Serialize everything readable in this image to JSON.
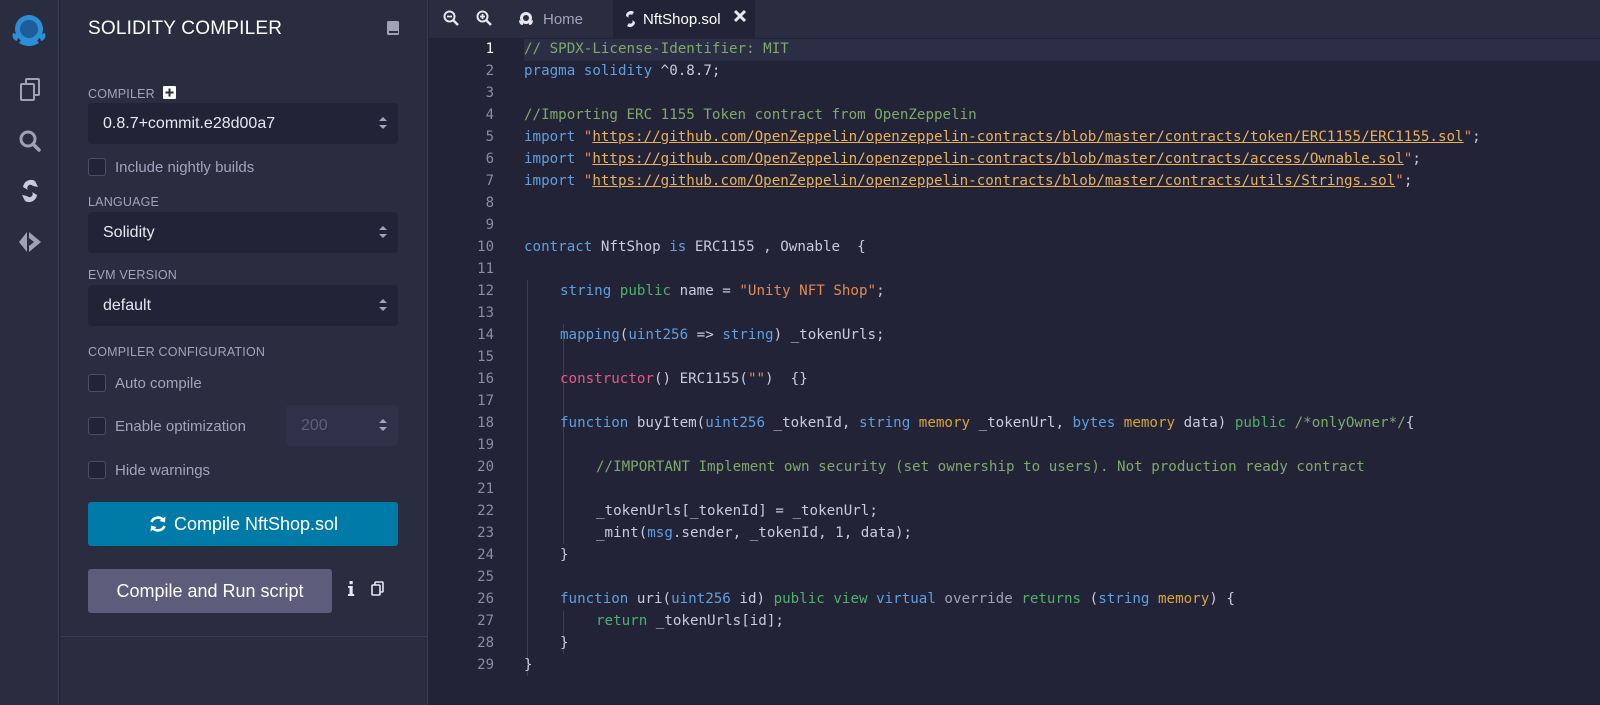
{
  "rail": {
    "items": [
      "remix-logo-icon",
      "file-explorer-icon",
      "search-icon",
      "solidity-compiler-icon",
      "deploy-run-icon"
    ]
  },
  "panel": {
    "title": "SOLIDITY COMPILER",
    "compiler_label": "COMPILER",
    "compiler_version": "0.8.7+commit.e28d00a7",
    "nightly_label": "Include nightly builds",
    "language_label": "LANGUAGE",
    "language_value": "Solidity",
    "evm_label": "EVM VERSION",
    "evm_value": "default",
    "config_label": "COMPILER CONFIGURATION",
    "auto_compile_label": "Auto compile",
    "optimization_label": "Enable optimization",
    "runs_value": "200",
    "hide_warnings_label": "Hide warnings",
    "compile_button": "Compile NftShop.sol",
    "run_script_button": "Compile and Run script"
  },
  "tabs": {
    "home": "Home",
    "file": "NftShop.sol"
  },
  "editor": {
    "line_numbers": [
      "1",
      "2",
      "3",
      "4",
      "5",
      "6",
      "7",
      "8",
      "9",
      "10",
      "11",
      "12",
      "13",
      "14",
      "15",
      "16",
      "17",
      "18",
      "19",
      "20",
      "21",
      "22",
      "23",
      "24",
      "25",
      "26",
      "27",
      "28",
      "29"
    ],
    "code": {
      "l1": "// SPDX-License-Identifier: MIT",
      "l2_kw": "pragma solidity",
      "l2_rest": " ^0.8.7;",
      "l4": "//Importing ERC 1155 Token contract from OpenZeppelin",
      "import_kw": "import",
      "q": "\"",
      "semi": ";",
      "l5_url": "https://github.com/OpenZeppelin/openzeppelin-contracts/blob/master/contracts/token/ERC1155/ERC1155.sol",
      "l6_url": "https://github.com/OpenZeppelin/openzeppelin-contracts/blob/master/contracts/access/Ownable.sol",
      "l7_url": "https://github.com/OpenZeppelin/openzeppelin-contracts/blob/master/contracts/utils/Strings.sol",
      "l10_kw1": "contract",
      "l10_a": " NftShop ",
      "l10_kw2": "is",
      "l10_b": " ERC1155 , Ownable  {",
      "l12_kw": "string",
      "l12_pub": "public",
      "l12_a": " name = ",
      "l12_str": "\"Unity NFT Shop\"",
      "l12_b": ";",
      "l14_kw": "mapping",
      "l14_a": "(",
      "l14_t1": "uint256",
      "l14_b": " => ",
      "l14_t2": "string",
      "l14_c": ") _tokenUrls;",
      "l16_ctor": "constructor",
      "l16_a": "() ERC1155(",
      "l16_str": "\"\"",
      "l16_b": ")  {}",
      "l18_fn": "function",
      "l18_a": " buyItem(",
      "l18_t1": "uint256",
      "l18_b": " _tokenId, ",
      "l18_t2": "string",
      "l18_mem1": "memory",
      "l18_c": " _tokenUrl, ",
      "l18_t3": "bytes",
      "l18_mem2": "memory",
      "l18_d": " data) ",
      "l18_pub": "public",
      "l18_com": "/*onlyOwner*/",
      "l18_e": "{",
      "l20": "//IMPORTANT Implement own security (set ownership to users). Not production ready contract",
      "l22": "_tokenUrls[_tokenId] = _tokenUrl;",
      "l23_a": "_mint(",
      "l23_msg": "msg",
      "l23_b": ".sender, _tokenId, 1, data);",
      "close_brace": "}",
      "l26_fn": "function",
      "l26_a": " uri(",
      "l26_t1": "uint256",
      "l26_b": " id) ",
      "l26_pub": "public",
      "l26_view": "view",
      "l26_virt": "virtual",
      "l26_over": " override ",
      "l26_ret": "returns",
      "l26_c": " (",
      "l26_t2": "string",
      "l26_mem": "memory",
      "l26_d": ") {",
      "l27_ret": "return",
      "l27_a": " _tokenUrls[id];"
    }
  },
  "colors": {
    "accent": "#007aa6",
    "background": "#222336",
    "panel": "#2a2c3f"
  }
}
